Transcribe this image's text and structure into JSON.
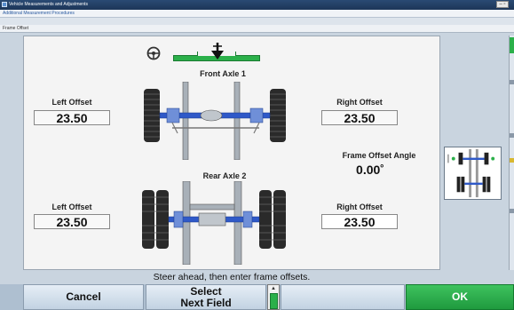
{
  "window": {
    "title": "Vehicle Measurements and Adjustments",
    "controls": "– ▫"
  },
  "menu": {
    "item": "Additional Measurement Procedures"
  },
  "breadcrumb": "Frame Offset",
  "front_axle": {
    "label": "Front Axle 1",
    "left_offset_label": "Left Offset",
    "left_offset_value": "23.50",
    "right_offset_label": "Right Offset",
    "right_offset_value": "23.50"
  },
  "frame_offset_angle": {
    "label": "Frame Offset Angle",
    "value": "0.00˚"
  },
  "rear_axle": {
    "label": "Rear Axle 2",
    "left_offset_label": "Left Offset",
    "left_offset_value": "23.50",
    "right_offset_label": "Right Offset",
    "right_offset_value": "23.50"
  },
  "status": "Steer ahead, then enter frame offsets.",
  "toolbar": {
    "cancel": "Cancel",
    "select_line1": "Select",
    "select_line2": "Next Field",
    "blank": "",
    "ok": "OK"
  },
  "colors": {
    "accent_green": "#2bb04a",
    "axle_blue": "#2f59c8",
    "title_bar": "#1d3658"
  },
  "icons": {
    "steering": "steering-wheel-icon",
    "level_pointer": "arrow-down-icon",
    "scroll_up": "chevron-up-icon"
  }
}
